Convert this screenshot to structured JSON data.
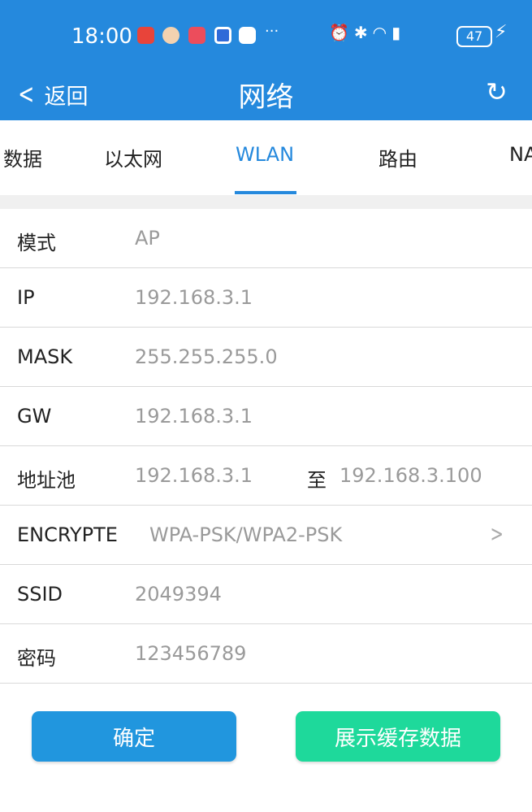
{
  "status_bar": {
    "time": "18:00",
    "more": "···",
    "battery": "47"
  },
  "header": {
    "back_label": "返回",
    "title": "网络"
  },
  "tabs": [
    {
      "label": "数据"
    },
    {
      "label": "以太网"
    },
    {
      "label": "WLAN"
    },
    {
      "label": "路由"
    },
    {
      "label": "NA"
    }
  ],
  "active_tab": "WLAN",
  "form": {
    "mode": {
      "label": "模式",
      "value": "AP"
    },
    "ip": {
      "label": "IP",
      "value": "192.168.3.1"
    },
    "mask": {
      "label": "MASK",
      "value": "255.255.255.0"
    },
    "gw": {
      "label": "GW",
      "value": "192.168.3.1"
    },
    "pool": {
      "label": "地址池",
      "start": "192.168.3.1",
      "to": "至",
      "end": "192.168.3.100"
    },
    "encrypt": {
      "label": "ENCRYPTE",
      "value": "WPA-PSK/WPA2-PSK"
    },
    "ssid": {
      "label": "SSID",
      "value": "2049394"
    },
    "password": {
      "label": "密码",
      "value": "123456789"
    }
  },
  "buttons": {
    "confirm": "确定",
    "show_cache": "展示缓存数据"
  },
  "colors": {
    "header": "#2589dd",
    "accent": "#2589dd",
    "confirm_button": "#2196de",
    "cache_button": "#1ed99b"
  },
  "icons": {
    "back": "chevron-left-icon",
    "refresh": "refresh-icon",
    "select": "chevron-right-icon"
  }
}
